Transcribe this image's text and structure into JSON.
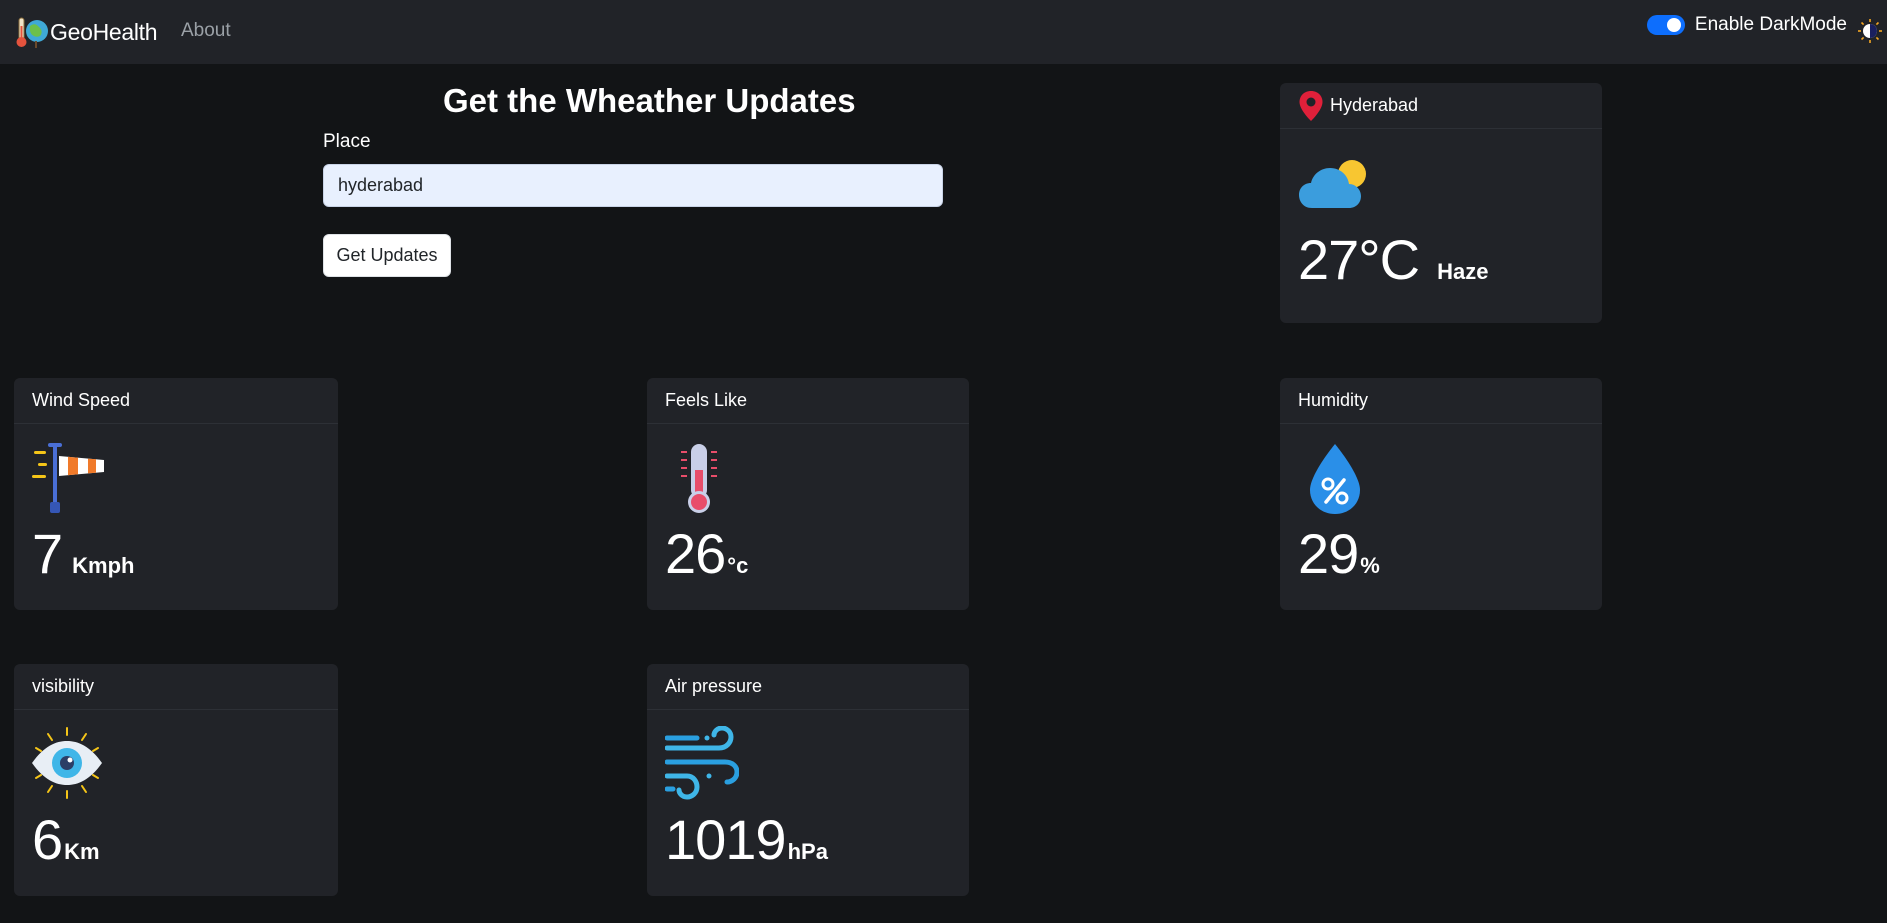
{
  "nav": {
    "brand": "GeoHealth",
    "about": "About",
    "darkmode_label": "Enable DarkMode",
    "darkmode_on": true
  },
  "search": {
    "title": "Get the Wheather Updates",
    "place_label": "Place",
    "place_value": "hyderabad",
    "button_label": "Get Updates"
  },
  "current": {
    "place": "Hyderabad",
    "temperature": "27°C",
    "condition": "Haze",
    "icon": "cloud-sun-icon"
  },
  "cards": {
    "wind": {
      "title": "Wind Speed",
      "value": "7",
      "unit": "Kmph",
      "icon": "windsock-icon"
    },
    "feels": {
      "title": "Feels Like",
      "value": "26",
      "unit": "°c",
      "icon": "thermometer-icon"
    },
    "humidity": {
      "title": "Humidity",
      "value": "29",
      "unit": "%",
      "icon": "humidity-drop-icon"
    },
    "visibility": {
      "title": "visibility",
      "value": "6",
      "unit": "Km",
      "icon": "eye-icon"
    },
    "pressure": {
      "title": "Air pressure",
      "value": "1019",
      "unit": "hPa",
      "icon": "wind-lines-icon"
    }
  },
  "colors": {
    "background": "#121416",
    "navbar": "#212328",
    "card": "#212328",
    "accent": "#0d6efd",
    "pin": "#e0203a"
  }
}
